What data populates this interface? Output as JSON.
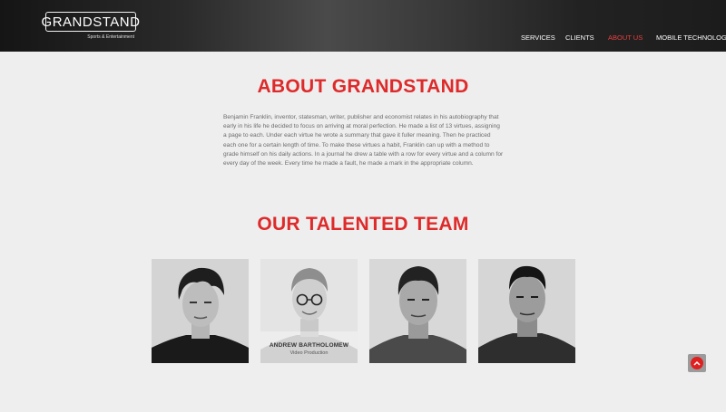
{
  "header": {
    "logo_text": "GRANDSTAND",
    "logo_subtitle": "Sports & Entertainment",
    "nav": [
      {
        "label": "SERVICES",
        "active": false
      },
      {
        "label": "CLIENTS",
        "active": false
      },
      {
        "label": "ABOUT US",
        "active": true
      },
      {
        "label": "MOBILE TECHNOLOGY",
        "active": false
      }
    ]
  },
  "about": {
    "title": "ABOUT GRANDSTAND",
    "body": "Benjamin Franklin, inventor, statesman, writer, publisher and economist relates in his autobiography that early in his life he decided to focus on arriving at moral perfection. He made a list of 13 virtues, assigning a page to each. Under each virtue he wrote a summary that gave it fuller meaning. Then he practiced each one for a certain length of time. To make these virtues a habit, Franklin can up with a method to grade himself on his daily actions. In a journal he drew a table with a row for every virtue and a column for every day of the week. Every time he made a fault, he made a mark in the appropriate column."
  },
  "team": {
    "title": "OUR TALENTED TEAM",
    "members": [
      {
        "name": "",
        "role": ""
      },
      {
        "name": "ANDREW BARTHOLOMEW",
        "role": "Video Production"
      },
      {
        "name": "",
        "role": ""
      },
      {
        "name": "",
        "role": ""
      }
    ]
  },
  "colors": {
    "accent": "#de2a2a",
    "header_bg": "#2b2b2b",
    "page_bg": "#efeeee"
  },
  "scroll_top": {
    "icon": "chevron-up-icon"
  }
}
